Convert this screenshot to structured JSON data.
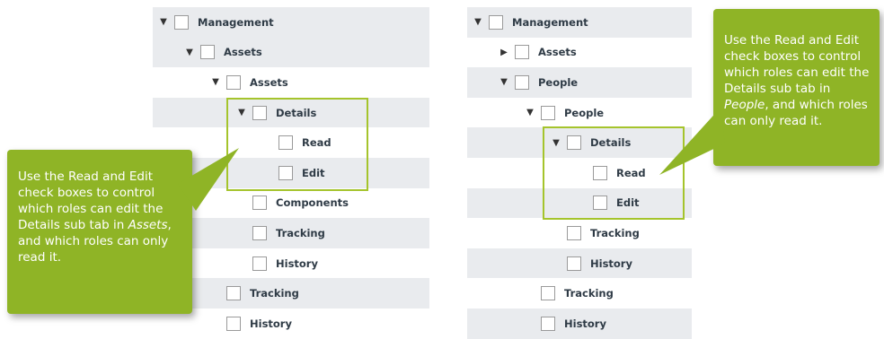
{
  "left_tree": [
    {
      "label": "Management",
      "arrow": "▼",
      "level": 0,
      "shade": true
    },
    {
      "label": "Assets",
      "arrow": "▼",
      "level": 1,
      "shade": true
    },
    {
      "label": "Assets",
      "arrow": "▼",
      "level": 2,
      "shade": false
    },
    {
      "label": "Details",
      "arrow": "▼",
      "level": 3,
      "shade": true
    },
    {
      "label": "Read",
      "arrow": "",
      "level": 4,
      "shade": false
    },
    {
      "label": "Edit",
      "arrow": "",
      "level": 4,
      "shade": true
    },
    {
      "label": "Components",
      "arrow": "",
      "level": 3,
      "shade": false
    },
    {
      "label": "Tracking",
      "arrow": "",
      "level": 3,
      "shade": true
    },
    {
      "label": "History",
      "arrow": "",
      "level": 3,
      "shade": false
    },
    {
      "label": "Tracking",
      "arrow": "",
      "level": 2,
      "shade": true
    },
    {
      "label": "History",
      "arrow": "",
      "level": 2,
      "shade": false
    }
  ],
  "right_tree": [
    {
      "label": "Management",
      "arrow": "▼",
      "level": 0,
      "shade": true
    },
    {
      "label": "Assets",
      "arrow": "▶",
      "level": 1,
      "shade": false
    },
    {
      "label": "People",
      "arrow": "▼",
      "level": 1,
      "shade": true
    },
    {
      "label": "People",
      "arrow": "▼",
      "level": 2,
      "shade": false
    },
    {
      "label": "Details",
      "arrow": "▼",
      "level": 3,
      "shade": true
    },
    {
      "label": "Read",
      "arrow": "",
      "level": 4,
      "shade": false
    },
    {
      "label": "Edit",
      "arrow": "",
      "level": 4,
      "shade": true
    },
    {
      "label": "Tracking",
      "arrow": "",
      "level": 3,
      "shade": false
    },
    {
      "label": "History",
      "arrow": "",
      "level": 3,
      "shade": true
    },
    {
      "label": "Tracking",
      "arrow": "",
      "level": 2,
      "shade": false
    },
    {
      "label": "History",
      "arrow": "",
      "level": 2,
      "shade": true
    }
  ],
  "callout_left": {
    "pre": "Use the Read and Edit check boxes to control which roles can edit the Details sub tab in ",
    "em": "Assets",
    "post": ", and which roles can only read it."
  },
  "callout_right": {
    "pre": "Use the Read and Edit check boxes to control which roles can edit the Details sub tab in ",
    "em": "People",
    "post": ", and which roles can only read it."
  },
  "colors": {
    "callout_bg": "#8fb426",
    "highlight_border": "#a5c42c",
    "row_shade": "#e9ebee",
    "label_text": "#2f3b46"
  }
}
